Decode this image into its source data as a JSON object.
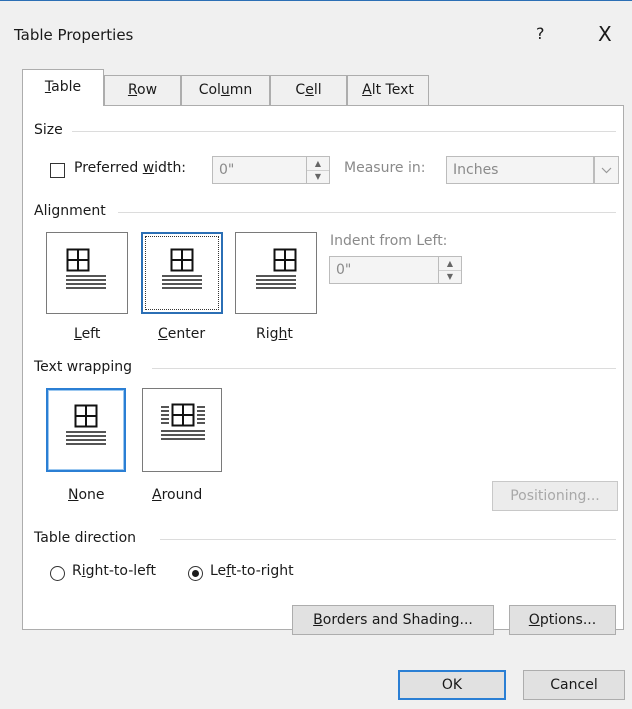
{
  "dialog": {
    "title": "Table Properties",
    "help": "?",
    "close": "X"
  },
  "tabs": [
    {
      "label": "Table",
      "key": "T",
      "rest": "able",
      "pre": ""
    },
    {
      "label": "Row",
      "pre": "",
      "key": "R",
      "rest": "ow"
    },
    {
      "label": "Column",
      "pre": "Col",
      "key": "u",
      "rest": "mn"
    },
    {
      "label": "Cell",
      "pre": "C",
      "key": "e",
      "rest": "ll"
    },
    {
      "label": "Alt Text",
      "pre": "",
      "key": "A",
      "rest": "lt Text"
    }
  ],
  "size": {
    "section": "Size",
    "preferred_pre": "Preferred ",
    "preferred_key": "w",
    "preferred_rest": "idth:",
    "width_value": "0\"",
    "measure_label": "Measure in:",
    "measure_value": "Inches"
  },
  "alignment": {
    "section": "Alignment",
    "indent_label": "Indent from Left:",
    "indent_value": "0\"",
    "left": {
      "key": "L",
      "rest": "eft"
    },
    "center": {
      "key": "C",
      "rest": "enter"
    },
    "right": {
      "pre": "Rig",
      "key": "h",
      "rest": "t"
    }
  },
  "wrapping": {
    "section": "Text wrapping",
    "none": {
      "key": "N",
      "rest": "one"
    },
    "around": {
      "key": "A",
      "rest": "round"
    },
    "positioning": "Positioning..."
  },
  "direction": {
    "section": "Table direction",
    "rtl_pre": "R",
    "rtl_key": "i",
    "rtl_rest": "ght-to-left",
    "ltr_pre": "Le",
    "ltr_key": "f",
    "ltr_rest": "t-to-right"
  },
  "buttons": {
    "borders_key": "B",
    "borders_rest": "orders and Shading...",
    "options_key": "O",
    "options_rest": "ptions...",
    "ok": "OK",
    "cancel": "Cancel"
  },
  "colors": {
    "accent": "#2b7fd4",
    "panel": "#ffffff",
    "dialog_bg": "#f0f0f0"
  }
}
